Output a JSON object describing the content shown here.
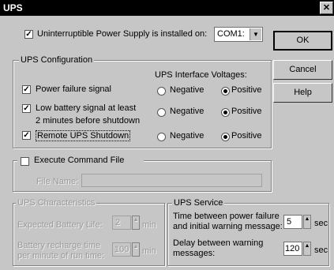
{
  "window": {
    "title": "UPS",
    "close_glyph": "✕"
  },
  "installed": {
    "label": "Uninterruptible Power Supply is installed on:",
    "checked": true,
    "port": "COM1:"
  },
  "buttons": {
    "ok": "OK",
    "cancel": "Cancel",
    "help": "Help"
  },
  "config": {
    "legend": "UPS Configuration",
    "voltages_header": "UPS Interface Voltages:",
    "rows": [
      {
        "label": "Power failure signal",
        "checked": true,
        "neg": "Negative",
        "pos": "Positive",
        "selected": "Positive"
      },
      {
        "label": "Low battery signal at least",
        "label2": "2 minutes before shutdown",
        "checked": true,
        "neg": "Negative",
        "pos": "Positive",
        "selected": "Positive"
      },
      {
        "label": "Remote UPS Shutdown",
        "checked": true,
        "neg": "Negative",
        "pos": "Positive",
        "selected": "Positive"
      }
    ]
  },
  "command": {
    "label": "Execute Command File",
    "checked": false,
    "file_label": "File Name:",
    "file_value": ""
  },
  "characteristics": {
    "legend": "UPS Characteristics",
    "battery_life_label": "Expected Battery Life:",
    "battery_life_value": "2",
    "battery_life_unit": "min",
    "recharge_label1": "Battery recharge time",
    "recharge_label2": "per minute of run time:",
    "recharge_value": "100",
    "recharge_unit": "min"
  },
  "service": {
    "legend": "UPS Service",
    "time_label1": "Time between power failure",
    "time_label2": "and initial warning message:",
    "time_value": "5",
    "time_unit": "sec",
    "delay_label1": "Delay between warning",
    "delay_label2": "messages:",
    "delay_value": "120",
    "delay_unit": "sec"
  },
  "icons": {
    "checkbox_mark": "✓",
    "dropdown": "▼",
    "spin_up": "▲",
    "spin_down": "▼"
  }
}
